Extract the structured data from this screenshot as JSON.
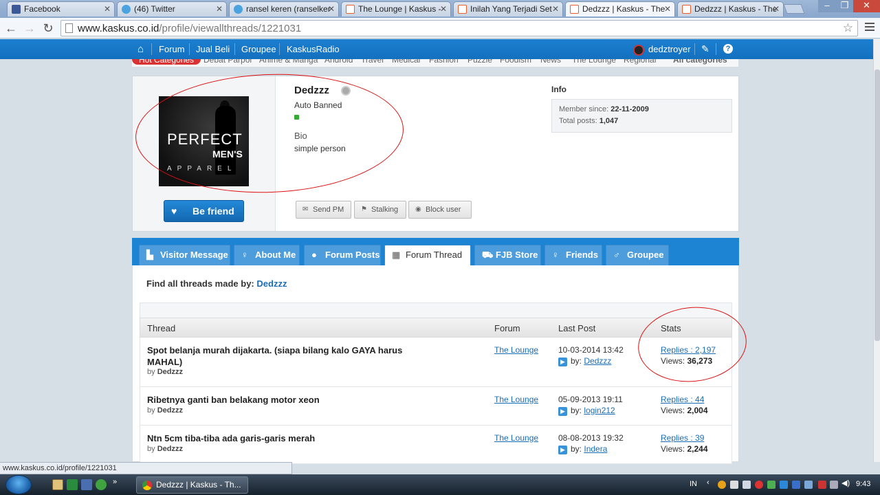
{
  "browser": {
    "tabs": [
      {
        "title": "Facebook",
        "favicon_color": "#3b5998"
      },
      {
        "title": "(46) Twitter",
        "favicon_color": "#4aa3df"
      },
      {
        "title": "ransel keren (ranselker",
        "favicon_color": "#4aa3df"
      },
      {
        "title": "The Lounge | Kaskus -",
        "favicon_color": "#e85d2a"
      },
      {
        "title": "Inilah Yang Terjadi Set",
        "favicon_color": "#e85d2a"
      },
      {
        "title": "Dedzzz | Kaskus - The",
        "favicon_color": "#e85d2a",
        "active": true
      },
      {
        "title": "Dedzzz | Kaskus - The",
        "favicon_color": "#e85d2a"
      }
    ],
    "url_host": "www.kaskus.co.id",
    "url_path": "/profile/viewallthreads/1221031",
    "status_url": "www.kaskus.co.id/profile/1221031"
  },
  "sitenav": {
    "items": [
      "Forum",
      "Jual Beli",
      "Groupee",
      "KaskusRadio"
    ],
    "username": "dedztroyer"
  },
  "categories": {
    "hot": "Hot Categories",
    "items": [
      "Debat Parpol",
      "Anime & Manga",
      "Android",
      "Travel",
      "Medical",
      "Fashion",
      "Puzzle",
      "Foodism",
      "News",
      "The Lounge",
      "Regional"
    ],
    "all": "All categories"
  },
  "profile": {
    "name": "Dedzzz",
    "role": "Auto Banned",
    "bio_label": "Bio",
    "bio": "simple person",
    "avatar_text": {
      "line1": "PERFECT",
      "line2": "MEN'S",
      "line3": "APPAREL"
    },
    "befriend": "Be friend",
    "actions": [
      "Send PM",
      "Stalking",
      "Block user"
    ],
    "info_title": "Info",
    "member_since_label": "Member since:",
    "member_since": "22-11-2009",
    "total_posts_label": "Total posts:",
    "total_posts": "1,047"
  },
  "tabs": [
    {
      "label": "Visitor Message",
      "icon": "comment-icon"
    },
    {
      "label": "About Me",
      "icon": "bulb-icon"
    },
    {
      "label": "Forum Posts",
      "icon": "chat-bubble-icon"
    },
    {
      "label": "Forum Thread",
      "icon": "calendar-icon",
      "active": true
    },
    {
      "label": "FJB Store",
      "icon": "cart-icon"
    },
    {
      "label": "Friends",
      "icon": "bulb-icon"
    },
    {
      "label": "Groupee",
      "icon": "group-icon"
    }
  ],
  "threads_section": {
    "find_label": "Find all threads made by:",
    "find_user": "Dedzzz",
    "columns": [
      "Thread",
      "Forum",
      "Last Post",
      "Stats"
    ],
    "rows": [
      {
        "title_line1": "Spot belanja murah dijakarta. (siapa bilang kalo GAYA harus",
        "title_line2": "MAHAL)",
        "by_label": "by",
        "by": "Dedzzz",
        "forum": "The Lounge",
        "date": "10-03-2014 13:42",
        "lp_label": "by:",
        "lp_user": "Dedzzz",
        "replies": "Replies : 2,197",
        "views_label": "Views:",
        "views": "36,273"
      },
      {
        "title_line1": "Ribetnya ganti ban belakang motor xeon",
        "title_line2": "",
        "by_label": "by",
        "by": "Dedzzz",
        "forum": "The Lounge",
        "date": "05-09-2013 19:11",
        "lp_label": "by:",
        "lp_user": "login212",
        "replies": "Replies : 44",
        "views_label": "Views:",
        "views": "2,004"
      },
      {
        "title_line1": "Ntn 5cm tiba-tiba ada garis-garis merah",
        "title_line2": "",
        "by_label": "by",
        "by": "Dedzzz",
        "forum": "The Lounge",
        "date": "08-08-2013 19:32",
        "lp_label": "by:",
        "lp_user": "Indera",
        "replies": "Replies : 39",
        "views_label": "Views:",
        "views": "2,244"
      }
    ]
  },
  "taskbar": {
    "task_title": "Dedzzz | Kaskus - Th...",
    "lang": "IN",
    "clock": "9:43"
  },
  "colors": {
    "kaskus_blue": "#1d83d3",
    "annotation_red": "#dd1111"
  }
}
